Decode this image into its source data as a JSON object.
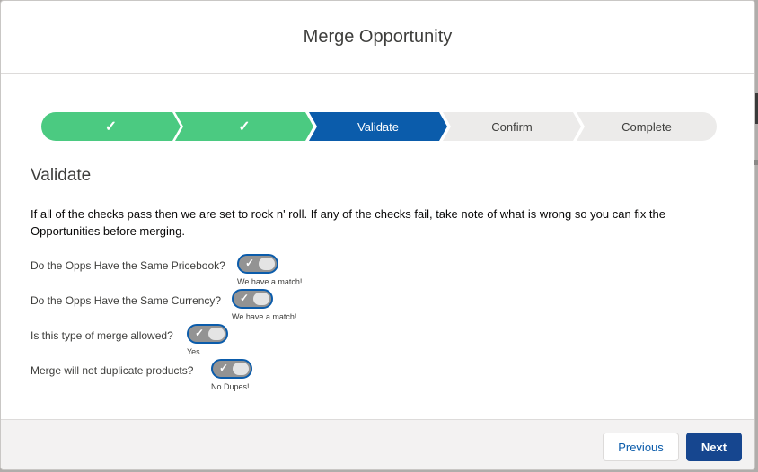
{
  "modal": {
    "title": "Merge Opportunity"
  },
  "path": {
    "steps": [
      {
        "label": "✓",
        "status": "complete"
      },
      {
        "label": "✓",
        "status": "complete"
      },
      {
        "label": "Validate",
        "status": "current"
      },
      {
        "label": "Confirm",
        "status": "incomplete"
      },
      {
        "label": "Complete",
        "status": "incomplete"
      }
    ],
    "colors": {
      "complete": "#4bca81",
      "current": "#0b5cab",
      "incomplete": "#ecebea"
    }
  },
  "section": {
    "title": "Validate",
    "intro": "If all of the checks pass then we are set to rock n' roll. If any of the checks fail, take note of what is wrong so you can fix the Opportunities before merging."
  },
  "checks": [
    {
      "label": "Do the Opps Have the Same Pricebook?",
      "status": "We have a match!",
      "checked": true
    },
    {
      "label": "Do the Opps Have the Same Currency?",
      "status": "We have a match!",
      "checked": true
    },
    {
      "label": "Is this type of merge allowed?",
      "status": "Yes",
      "checked": true
    },
    {
      "label": "Merge will not duplicate products?",
      "status": "No Dupes!",
      "checked": true
    }
  ],
  "footer": {
    "previous_label": "Previous",
    "next_label": "Next"
  }
}
